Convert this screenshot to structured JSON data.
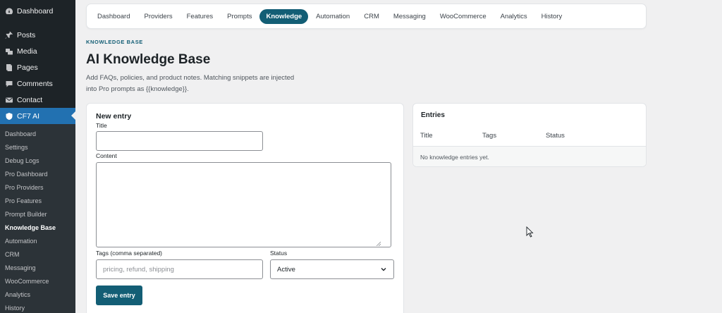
{
  "sidebar": {
    "top_items": [
      {
        "label": "Dashboard",
        "icon": "dashboard-icon"
      },
      {
        "label": "Posts",
        "icon": "pin-icon"
      },
      {
        "label": "Media",
        "icon": "media-icon"
      },
      {
        "label": "Pages",
        "icon": "pages-icon"
      },
      {
        "label": "Comments",
        "icon": "comment-icon"
      },
      {
        "label": "Contact",
        "icon": "mail-icon"
      },
      {
        "label": "CF7 AI",
        "icon": "shield-icon",
        "active": true
      }
    ],
    "submenu": [
      {
        "label": "Dashboard"
      },
      {
        "label": "Settings"
      },
      {
        "label": "Debug Logs"
      },
      {
        "label": "Pro Dashboard"
      },
      {
        "label": "Pro Providers"
      },
      {
        "label": "Pro Features"
      },
      {
        "label": "Prompt Builder"
      },
      {
        "label": "Knowledge Base",
        "current": true
      },
      {
        "label": "Automation"
      },
      {
        "label": "CRM"
      },
      {
        "label": "Messaging"
      },
      {
        "label": "WooCommerce"
      },
      {
        "label": "Analytics"
      },
      {
        "label": "History"
      }
    ]
  },
  "tabs": [
    {
      "label": "Dashboard"
    },
    {
      "label": "Providers"
    },
    {
      "label": "Features"
    },
    {
      "label": "Prompts"
    },
    {
      "label": "Knowledge",
      "active": true
    },
    {
      "label": "Automation"
    },
    {
      "label": "CRM"
    },
    {
      "label": "Messaging"
    },
    {
      "label": "WooCommerce"
    },
    {
      "label": "Analytics"
    },
    {
      "label": "History"
    }
  ],
  "header": {
    "eyebrow": "KNOWLEDGE BASE",
    "title": "AI Knowledge Base",
    "description": "Add FAQs, policies, and product notes. Matching snippets are injected into Pro prompts as {{knowledge}}."
  },
  "form": {
    "heading": "New entry",
    "title_label": "Title",
    "title_value": "",
    "content_label": "Content",
    "content_value": "",
    "tags_label": "Tags (comma separated)",
    "tags_placeholder": "pricing, refund, shipping",
    "status_label": "Status",
    "status_value": "Active",
    "save_label": "Save entry"
  },
  "entries": {
    "heading": "Entries",
    "columns": [
      "Title",
      "Tags",
      "Status"
    ],
    "empty_text": "No knowledge entries yet."
  },
  "colors": {
    "accent": "#135e75",
    "sidebar_bg": "#1d2327",
    "sidebar_active": "#2271b1"
  }
}
